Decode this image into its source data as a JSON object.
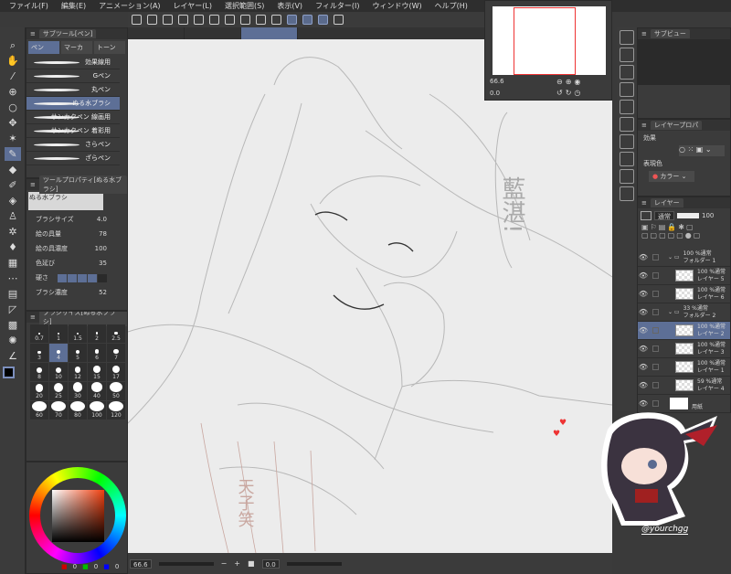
{
  "menu": [
    "ファイル(F)",
    "編集(E)",
    "アニメーション(A)",
    "レイヤー(L)",
    "選択範囲(S)",
    "表示(V)",
    "フィルター(I)",
    "ウィンドウ(W)",
    "ヘルプ(H)"
  ],
  "subtool": {
    "title": "サブツール[ペン]",
    "tabs": [
      "ペン",
      "マーカ",
      "トーン"
    ],
    "brushes": [
      "効果線用",
      "Gペン",
      "丸ペン",
      "ぬる水ブラシ",
      "サンカクペン 線画用",
      "サンカクペン 着彩用",
      "さらペン",
      "ざらペン"
    ],
    "selected": 3
  },
  "toolprop": {
    "title": "ツールプロパティ[ぬる水ブラシ]",
    "preview_label": "ぬる水ブラシ",
    "props": [
      {
        "label": "ブラシサイズ",
        "value": "4.0"
      },
      {
        "label": "絵の具量",
        "value": "78"
      },
      {
        "label": "絵の具濃度",
        "value": "100"
      },
      {
        "label": "色延び",
        "value": "35"
      },
      {
        "label": "硬さ",
        "value": ""
      },
      {
        "label": "ブラシ濃度",
        "value": "52"
      }
    ],
    "hardness_level": 4
  },
  "brushsize": {
    "title": "ブラシサイズ[ぬる水ブラシ]",
    "sizes": [
      "0.7",
      "1",
      "1.5",
      "2",
      "2.5",
      "3",
      "4",
      "5",
      "6",
      "7",
      "8",
      "10",
      "12",
      "15",
      "17",
      "20",
      "25",
      "30",
      "40",
      "50",
      "60",
      "70",
      "80",
      "100",
      "120"
    ],
    "selected": "4"
  },
  "colors": {
    "main": "#000000",
    "sub": "#f0c8a0",
    "accent": "#5d6f96",
    "rgb": [
      "0",
      "0",
      "0"
    ]
  },
  "navigator": {
    "zoom": "66.6",
    "rotate": "0.0"
  },
  "status": {
    "zoom": "66.6",
    "rotate": "0.0"
  },
  "subview": {
    "title": "サブビュー"
  },
  "layerprop": {
    "title": "レイヤープロパ",
    "effect_label": "効果",
    "expression_label": "表現色",
    "expression_value": "カラー"
  },
  "layers": {
    "title": "レイヤー",
    "blend": "通常",
    "opacity": "100",
    "items": [
      {
        "mode": "100 %通常",
        "name": "フォルダー 1",
        "folder": true,
        "indent": 0
      },
      {
        "mode": "100 %通常",
        "name": "レイヤー 5",
        "indent": 1
      },
      {
        "mode": "100 %通常",
        "name": "レイヤー 6",
        "indent": 1
      },
      {
        "mode": "33 %通常",
        "name": "フォルダー 2",
        "folder": true,
        "indent": 0
      },
      {
        "mode": "100 %通常",
        "name": "レイヤー 2",
        "indent": 1,
        "selected": true
      },
      {
        "mode": "100 %通常",
        "name": "レイヤー 3",
        "indent": 1
      },
      {
        "mode": "100 %通常",
        "name": "レイヤー 1",
        "indent": 1
      },
      {
        "mode": "59 %通常",
        "name": "レイヤー 4",
        "indent": 1
      },
      {
        "mode": "",
        "name": "用紙",
        "indent": 0,
        "paper": true
      }
    ]
  },
  "canvas_text": {
    "speech": "藍湛!",
    "sketch_text": "天子笑"
  },
  "watermark": "@yourchgg"
}
